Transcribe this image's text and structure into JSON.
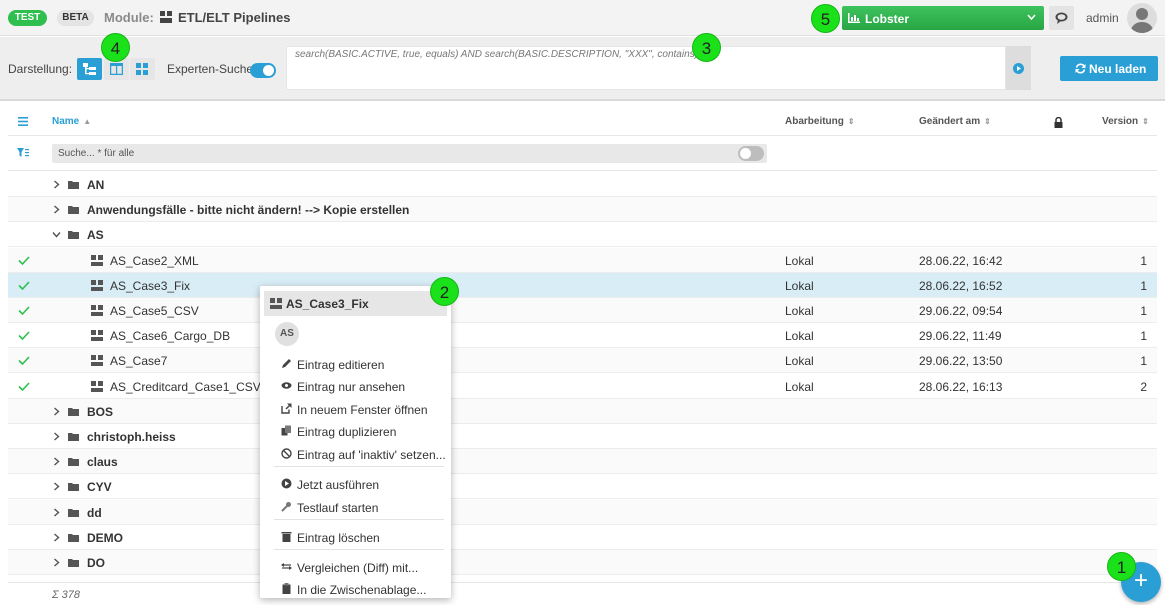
{
  "header": {
    "badge_test": "TEST",
    "badge_beta": "BETA",
    "module_label": "Module:",
    "module_name": "ETL/ELT Pipelines",
    "org_select": "Lobster",
    "user_name": "admin"
  },
  "toolbar": {
    "view_label": "Darstellung:",
    "expert_label": "Experten-Suche",
    "expert_query": "search(BASIC.ACTIVE, true, equals) AND search(BASIC.DESCRIPTION, \"XXX\", contains)",
    "reload_label": "Neu laden"
  },
  "table": {
    "columns": {
      "name": "Name",
      "processing": "Abarbeitung",
      "changed": "Geändert am",
      "version": "Version"
    },
    "filter_placeholder": "Suche... * für alle",
    "rows": [
      {
        "type": "folder",
        "expanded": false,
        "name": "AN"
      },
      {
        "type": "folder",
        "expanded": false,
        "name": "Anwendungsfälle - bitte nicht ändern! --> Kopie erstellen"
      },
      {
        "type": "folder",
        "expanded": true,
        "name": "AS"
      },
      {
        "type": "file",
        "name": "AS_Case2_XML",
        "processing": "Lokal",
        "changed": "28.06.22, 16:42",
        "version": "1",
        "active": true
      },
      {
        "type": "file",
        "name": "AS_Case3_Fix",
        "processing": "Lokal",
        "changed": "28.06.22, 16:52",
        "version": "1",
        "active": true,
        "selected": true
      },
      {
        "type": "file",
        "name": "AS_Case5_CSV",
        "processing": "Lokal",
        "changed": "29.06.22, 09:54",
        "version": "1",
        "active": true
      },
      {
        "type": "file",
        "name": "AS_Case6_Cargo_DB",
        "processing": "Lokal",
        "changed": "29.06.22, 11:49",
        "version": "1",
        "active": true
      },
      {
        "type": "file",
        "name": "AS_Case7",
        "processing": "Lokal",
        "changed": "29.06.22, 13:50",
        "version": "1",
        "active": true
      },
      {
        "type": "file",
        "name": "AS_Creditcard_Case1_CSV",
        "processing": "Lokal",
        "changed": "28.06.22, 16:13",
        "version": "2",
        "active": true
      },
      {
        "type": "folder",
        "expanded": false,
        "name": "BOS"
      },
      {
        "type": "folder",
        "expanded": false,
        "name": "christoph.heiss"
      },
      {
        "type": "folder",
        "expanded": false,
        "name": "claus"
      },
      {
        "type": "folder",
        "expanded": false,
        "name": "CYV"
      },
      {
        "type": "folder",
        "expanded": false,
        "name": "dd"
      },
      {
        "type": "folder",
        "expanded": false,
        "name": "DEMO"
      },
      {
        "type": "folder",
        "expanded": false,
        "name": "DO"
      }
    ],
    "total": "Σ 378"
  },
  "context_menu": {
    "title": "AS_Case3_Fix",
    "avatar": "AS",
    "items": [
      {
        "label": "Eintrag editieren",
        "icon": "pencil-icon"
      },
      {
        "label": "Eintrag nur ansehen",
        "icon": "eye-icon"
      },
      {
        "label": "In neuem Fenster öffnen",
        "icon": "external-link-icon"
      },
      {
        "label": "Eintrag duplizieren",
        "icon": "copy-icon"
      },
      {
        "label": "Eintrag auf 'inaktiv' setzen...",
        "icon": "ban-icon"
      },
      {
        "label": "Jetzt ausführen",
        "icon": "play-circle-icon"
      },
      {
        "label": "Testlauf starten",
        "icon": "wrench-icon"
      },
      {
        "label": "Eintrag löschen",
        "icon": "trash-icon"
      },
      {
        "label": "Vergleichen (Diff) mit...",
        "icon": "diff-arrows-icon"
      },
      {
        "label": "In die Zwischenablage...",
        "icon": "clipboard-icon"
      }
    ]
  },
  "markers": [
    "1",
    "2",
    "3",
    "4",
    "5"
  ],
  "fab_label": "+",
  "colors": {
    "accent": "#2a9fd6",
    "green": "#2fbf4f",
    "marker": "#1be11b",
    "selected_row": "#d9edf7"
  }
}
